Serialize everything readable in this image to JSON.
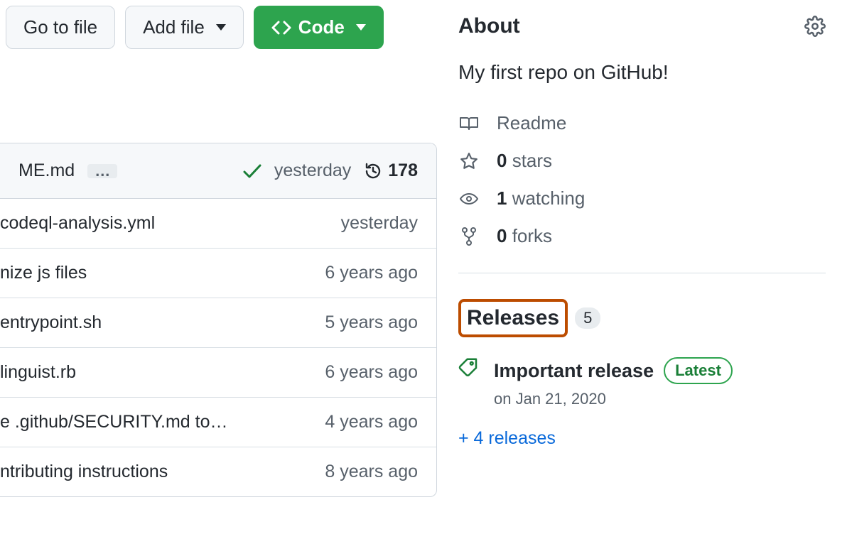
{
  "toolbar": {
    "go_to_file": "Go to file",
    "add_file": "Add file",
    "code": "Code"
  },
  "file_header": {
    "filename_fragment": "ME.md",
    "last_commit_time": "yesterday",
    "commit_count": "178"
  },
  "files": [
    {
      "message": " codeql-analysis.yml",
      "time": "yesterday"
    },
    {
      "message": "nize js files",
      "time": "6 years ago"
    },
    {
      "message": "entrypoint.sh",
      "time": "5 years ago"
    },
    {
      "message": "linguist.rb",
      "time": "6 years ago"
    },
    {
      "message": "e .github/SECURITY.md to…",
      "time": "4 years ago"
    },
    {
      "message": "ntributing instructions",
      "time": "8 years ago"
    }
  ],
  "about": {
    "title": "About",
    "description": "My first repo on GitHub!",
    "readme": "Readme",
    "stars_count": "0",
    "stars_label": " stars",
    "watching_count": "1",
    "watching_label": " watching",
    "forks_count": "0",
    "forks_label": " forks"
  },
  "releases": {
    "title": "Releases",
    "count": "5",
    "latest_name": "Important release",
    "latest_badge": "Latest",
    "latest_date": "on Jan 21, 2020",
    "more_link": "+ 4 releases"
  }
}
